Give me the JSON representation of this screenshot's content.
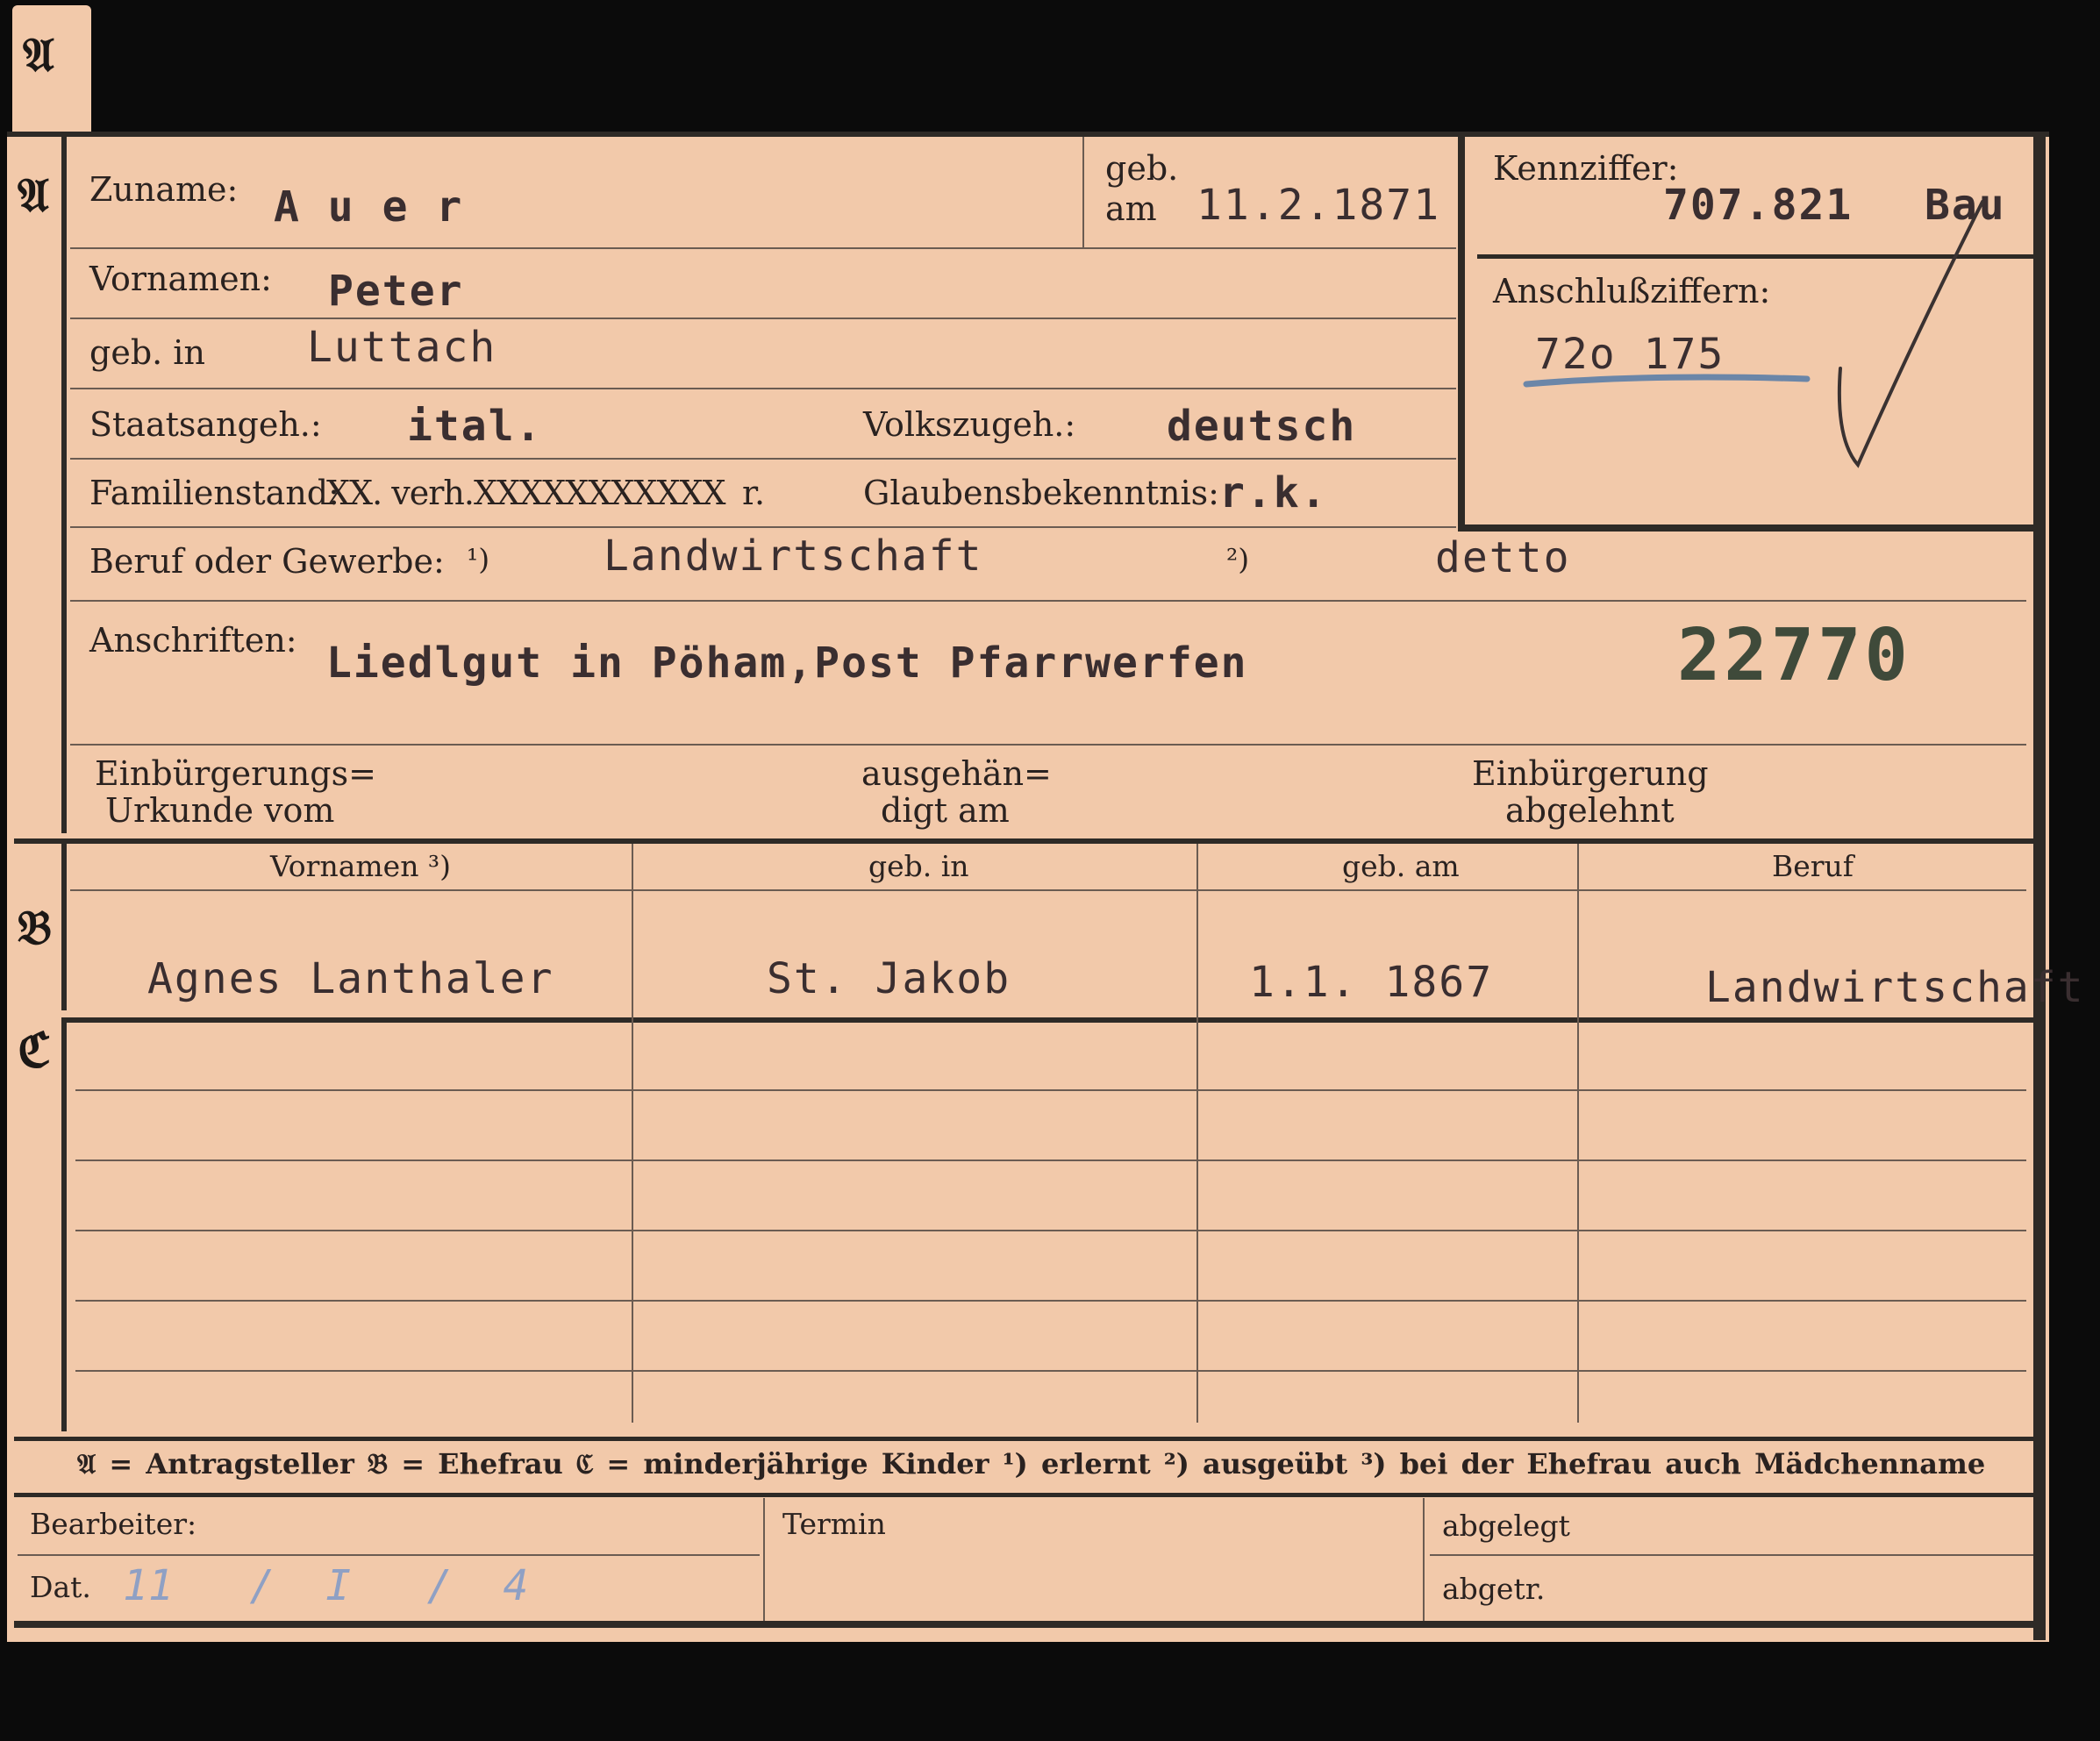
{
  "sections": {
    "a": "𝔄",
    "b": "𝔅",
    "c": "ℭ"
  },
  "header": {
    "zuname_label": "Zuname:",
    "zuname_value": "A u e r",
    "geb_label": "geb.",
    "am_label": "am",
    "geb_am_value": "11.2.1871",
    "kennziffer_label": "Kennziffer:",
    "kennziffer_value": "707.821",
    "kennziffer_suffix": "Bau",
    "anschluss_label": "Anschlußziffern:",
    "anschluss_value": "72o 175"
  },
  "person": {
    "vornamen_label": "Vornamen:",
    "vornamen_value": "Peter",
    "geb_in_label": "geb. in",
    "geb_in_value": "Luttach",
    "staatsangeh_label": "Staatsangeh.:",
    "staatsangeh_value": "ital.",
    "volkszugeh_label": "Volkszugeh.:",
    "volkszugeh_value": "deutsch",
    "familienstand_label": "Familienstand:",
    "familienstand_options": "XX. verh.XXXXXXXXXXX",
    "familienstand_tail": "r.",
    "glauben_label": "Glaubensbekenntnis:",
    "glauben_value": "r.k.",
    "beruf_label": "Beruf oder Gewerbe:",
    "beruf_mark1": "¹)",
    "beruf_value1": "Landwirtschaft",
    "beruf_mark2": "²)",
    "beruf_value2": "detto",
    "anschriften_label": "Anschriften:",
    "anschriften_value": "Liedlgut in Pöham,Post Pfarrwerfen",
    "stamp_number": "22770",
    "einb_label_1": "Einbürgerungs=",
    "einb_label_2": "Urkunde vom",
    "ausgeh_label_1": "ausgehän=",
    "ausgeh_label_2": "digt am",
    "abgelehnt_label_1": "Einbürgerung",
    "abgelehnt_label_2": "abgelehnt"
  },
  "table": {
    "headers": [
      "Vornamen ³)",
      "geb. in",
      "geb. am",
      "Beruf"
    ],
    "spouse": [
      "Agnes Lanthaler",
      "St. Jakob",
      "1.1. 1867",
      "Landwirtschaft"
    ]
  },
  "legend": "𝔄 = Antragsteller   𝔅 = Ehefrau   ℭ = minderjährige Kinder   ¹) erlernt   ²) ausgeübt   ³) bei der Ehefrau auch Mädchenname",
  "footer": {
    "bearbeiter_label": "Bearbeiter:",
    "dat_label": "Dat.",
    "dat_value": "11   /  I   /  4",
    "termin_label": "Termin",
    "abgelegt_label": "abgelegt",
    "abgetr_label": "abgetr."
  },
  "colors": {
    "card": "#f2c9aa",
    "ink": "#2a2220",
    "stamp": "#3f4a3a",
    "pencil_blue": "#6b86a8"
  }
}
